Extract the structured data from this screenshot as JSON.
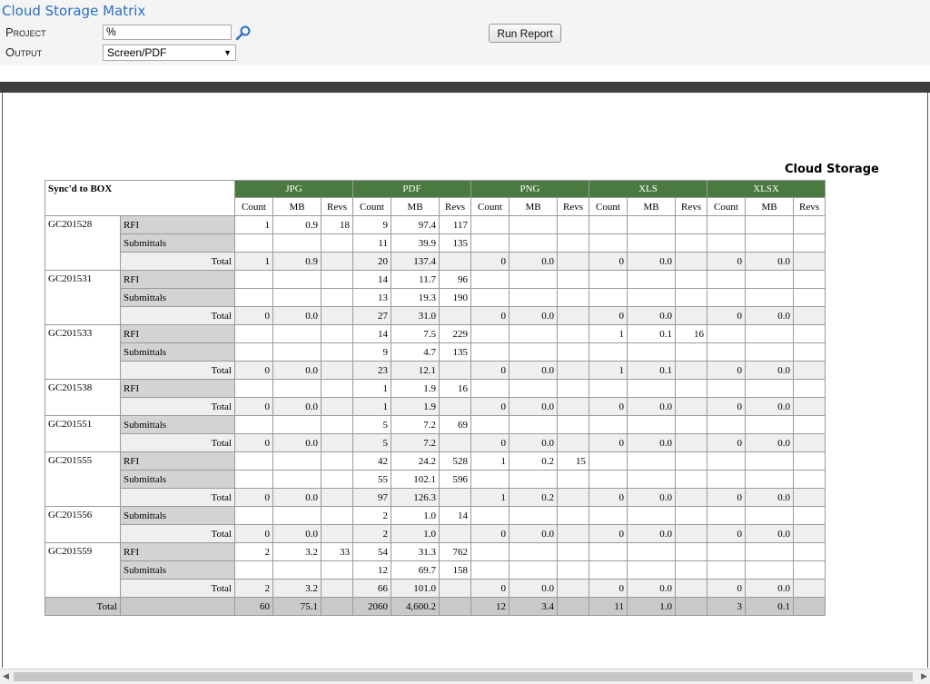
{
  "app_title": "Cloud Storage Matrix",
  "params": {
    "project_label": "Project",
    "project_value": "%",
    "output_label": "Output",
    "output_value": "Screen/PDF",
    "run_label": "Run Report"
  },
  "icons": {
    "search": "search-icon",
    "dropdown": "chevron-down-icon"
  },
  "colors": {
    "title_link": "#2a6fc2",
    "header_green": "#4a7a40",
    "doc_row": "#d3d3d3",
    "total_row": "#efefef"
  },
  "report": {
    "title": "Cloud Storage",
    "corner_label": "Sync'd to BOX",
    "types": [
      "JPG",
      "PDF",
      "PNG",
      "XLS",
      "XLSX"
    ],
    "subcols": [
      "Count",
      "MB",
      "Revs"
    ],
    "total_label": "Total",
    "projects": [
      {
        "id": "GC201528",
        "rows": [
          {
            "doc": "RFI",
            "cells": [
              "1",
              "0.9",
              "18",
              "9",
              "97.4",
              "117",
              "",
              "",
              "",
              "",
              "",
              "",
              "",
              "",
              ""
            ]
          },
          {
            "doc": "Submittals",
            "cells": [
              "",
              "",
              "",
              "11",
              "39.9",
              "135",
              "",
              "",
              "",
              "",
              "",
              "",
              "",
              "",
              ""
            ]
          },
          {
            "doc": "Total",
            "cells": [
              "1",
              "0.9",
              "",
              "20",
              "137.4",
              "",
              "0",
              "0.0",
              "",
              "0",
              "0.0",
              "",
              "0",
              "0.0",
              ""
            ]
          }
        ]
      },
      {
        "id": "GC201531",
        "rows": [
          {
            "doc": "RFI",
            "cells": [
              "",
              "",
              "",
              "14",
              "11.7",
              "96",
              "",
              "",
              "",
              "",
              "",
              "",
              "",
              "",
              ""
            ]
          },
          {
            "doc": "Submittals",
            "cells": [
              "",
              "",
              "",
              "13",
              "19.3",
              "190",
              "",
              "",
              "",
              "",
              "",
              "",
              "",
              "",
              ""
            ]
          },
          {
            "doc": "Total",
            "cells": [
              "0",
              "0.0",
              "",
              "27",
              "31.0",
              "",
              "0",
              "0.0",
              "",
              "0",
              "0.0",
              "",
              "0",
              "0.0",
              ""
            ]
          }
        ]
      },
      {
        "id": "GC201533",
        "rows": [
          {
            "doc": "RFI",
            "cells": [
              "",
              "",
              "",
              "14",
              "7.5",
              "229",
              "",
              "",
              "",
              "1",
              "0.1",
              "16",
              "",
              "",
              ""
            ]
          },
          {
            "doc": "Submittals",
            "cells": [
              "",
              "",
              "",
              "9",
              "4.7",
              "135",
              "",
              "",
              "",
              "",
              "",
              "",
              "",
              "",
              ""
            ]
          },
          {
            "doc": "Total",
            "cells": [
              "0",
              "0.0",
              "",
              "23",
              "12.1",
              "",
              "0",
              "0.0",
              "",
              "1",
              "0.1",
              "",
              "0",
              "0.0",
              ""
            ]
          }
        ]
      },
      {
        "id": "GC201538",
        "rows": [
          {
            "doc": "RFI",
            "cells": [
              "",
              "",
              "",
              "1",
              "1.9",
              "16",
              "",
              "",
              "",
              "",
              "",
              "",
              "",
              "",
              ""
            ]
          },
          {
            "doc": "Total",
            "cells": [
              "0",
              "0.0",
              "",
              "1",
              "1.9",
              "",
              "0",
              "0.0",
              "",
              "0",
              "0.0",
              "",
              "0",
              "0.0",
              ""
            ]
          }
        ]
      },
      {
        "id": "GC201551",
        "rows": [
          {
            "doc": "Submittals",
            "cells": [
              "",
              "",
              "",
              "5",
              "7.2",
              "69",
              "",
              "",
              "",
              "",
              "",
              "",
              "",
              "",
              ""
            ]
          },
          {
            "doc": "Total",
            "cells": [
              "0",
              "0.0",
              "",
              "5",
              "7.2",
              "",
              "0",
              "0.0",
              "",
              "0",
              "0.0",
              "",
              "0",
              "0.0",
              ""
            ]
          }
        ]
      },
      {
        "id": "GC201555",
        "rows": [
          {
            "doc": "RFI",
            "cells": [
              "",
              "",
              "",
              "42",
              "24.2",
              "528",
              "1",
              "0.2",
              "15",
              "",
              "",
              "",
              "",
              "",
              ""
            ]
          },
          {
            "doc": "Submittals",
            "cells": [
              "",
              "",
              "",
              "55",
              "102.1",
              "596",
              "",
              "",
              "",
              "",
              "",
              "",
              "",
              "",
              ""
            ]
          },
          {
            "doc": "Total",
            "cells": [
              "0",
              "0.0",
              "",
              "97",
              "126.3",
              "",
              "1",
              "0.2",
              "",
              "0",
              "0.0",
              "",
              "0",
              "0.0",
              ""
            ]
          }
        ]
      },
      {
        "id": "GC201556",
        "rows": [
          {
            "doc": "Submittals",
            "cells": [
              "",
              "",
              "",
              "2",
              "1.0",
              "14",
              "",
              "",
              "",
              "",
              "",
              "",
              "",
              "",
              ""
            ]
          },
          {
            "doc": "Total",
            "cells": [
              "0",
              "0.0",
              "",
              "2",
              "1.0",
              "",
              "0",
              "0.0",
              "",
              "0",
              "0.0",
              "",
              "0",
              "0.0",
              ""
            ]
          }
        ]
      },
      {
        "id": "GC201559",
        "rows": [
          {
            "doc": "RFI",
            "cells": [
              "2",
              "3.2",
              "33",
              "54",
              "31.3",
              "762",
              "",
              "",
              "",
              "",
              "",
              "",
              "",
              "",
              ""
            ]
          },
          {
            "doc": "Submittals",
            "cells": [
              "",
              "",
              "",
              "12",
              "69.7",
              "158",
              "",
              "",
              "",
              "",
              "",
              "",
              "",
              "",
              ""
            ]
          },
          {
            "doc": "Total",
            "cells": [
              "2",
              "3.2",
              "",
              "66",
              "101.0",
              "",
              "0",
              "0.0",
              "",
              "0",
              "0.0",
              "",
              "0",
              "0.0",
              ""
            ]
          }
        ]
      }
    ],
    "grand_total": {
      "label": "Total",
      "cells": [
        "60",
        "75.1",
        "",
        "2060",
        "4,600.2",
        "",
        "12",
        "3.4",
        "",
        "11",
        "1.0",
        "",
        "3",
        "0.1",
        ""
      ]
    }
  }
}
